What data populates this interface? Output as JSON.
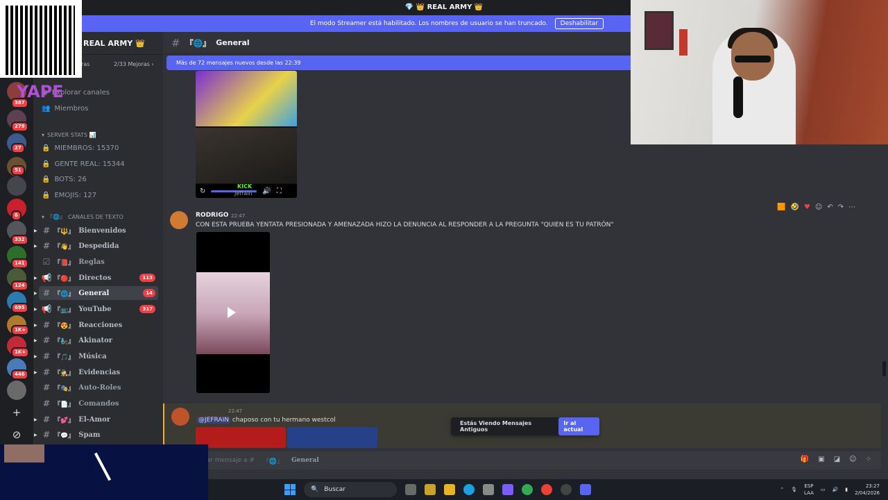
{
  "topbar": {
    "title": "💎 👑 REAL ARMY 👑"
  },
  "streamer": {
    "text": "El modo Streamer está habilitado. Los nombres de usuario se han truncado.",
    "button": "Deshabilitar"
  },
  "overlay": {
    "yape": "YAPE"
  },
  "guilds": [
    {
      "badge": "387"
    },
    {
      "badge": "279"
    },
    {
      "badge": "27"
    },
    {
      "badge": "51"
    },
    {
      "badge": ""
    },
    {
      "badge": "6"
    },
    {
      "badge": "332"
    },
    {
      "badge": "141"
    },
    {
      "badge": "124"
    },
    {
      "badge": "695"
    },
    {
      "badge": "1K+"
    },
    {
      "badge": "1K+"
    },
    {
      "badge": "446"
    },
    {
      "badge": ""
    }
  ],
  "server": {
    "name": "REAL ARMY 👑",
    "boosts": "2/33 Mejoras ›",
    "boost_prefix": "Mejoras"
  },
  "sidebar": {
    "explore": "Explorar canales",
    "members": "Miembros",
    "stats_category": "SERVER STATS 📊",
    "stats": [
      "MIEMBROS: 15370",
      "GENTE REAL: 15344",
      "BOTS: 26",
      "EMOJIS: 127"
    ],
    "text_category": "CANALES DE TEXTO",
    "text_cat_emoji": "『🌐』",
    "channels": [
      {
        "emoji": "『🔱』",
        "name": "Bienvenidos",
        "badge": ""
      },
      {
        "emoji": "『👋』",
        "name": "Despedida",
        "badge": ""
      },
      {
        "emoji": "『📕』",
        "name": "Reglas",
        "badge": ""
      },
      {
        "emoji": "『🔴』",
        "name": "Directos",
        "badge": "113"
      },
      {
        "emoji": "『🌐』",
        "name": "General",
        "badge": "14"
      },
      {
        "emoji": "『📺』",
        "name": "YouTube",
        "badge": "317"
      },
      {
        "emoji": "『😍』",
        "name": "Reacciones",
        "badge": ""
      },
      {
        "emoji": "『🧞』",
        "name": "Akinator",
        "badge": ""
      },
      {
        "emoji": "『🎵』",
        "name": "Música",
        "badge": ""
      },
      {
        "emoji": "『🕵』",
        "name": "Evidencias",
        "badge": ""
      },
      {
        "emoji": "『🎭』",
        "name": "Auto-Roles",
        "badge": ""
      },
      {
        "emoji": "『📄』",
        "name": "Comandos",
        "badge": ""
      },
      {
        "emoji": "『💕』",
        "name": "El-Amor",
        "badge": ""
      },
      {
        "emoji": "『💬』",
        "name": "Spam",
        "badge": ""
      }
    ]
  },
  "channel_header": {
    "emoji": "『🌐』",
    "name": "General"
  },
  "new_messages": "Más de 72 mensajes nuevos desde las 22:39",
  "video": {
    "watermark": "KICK",
    "overlay": "Jefrain"
  },
  "messages": [
    {
      "author": "RODRIGO",
      "time": "22:47",
      "text": "CON ESTA PRUEBA YENTATA PRESIONADA Y AMENAZADA HIZO LA DENUNCIA AL RESPONDER A LA PREGUNTA \"QUIEN ES TU PATRÓN\""
    },
    {
      "author": "",
      "time": "22:47",
      "mention": "@JEFRAIN",
      "text": "chaposo con tu hermano westcol"
    }
  ],
  "jump": {
    "label": "Estás Viendo Mensajes Antiguos",
    "button": "Ir al actual"
  },
  "composer": {
    "placeholder": "Enviar mensaje a #",
    "emoji": "『🌐』",
    "channel": "General"
  },
  "taskbar": {
    "search": "Buscar",
    "lang1": "ESP",
    "lang2": "LAA",
    "time": "23:27",
    "date": "2/04/2026"
  },
  "colors": {
    "accent": "#5865f2",
    "badge": "#f23f43",
    "bg": "#313338",
    "sidebar": "#2b2d31"
  }
}
